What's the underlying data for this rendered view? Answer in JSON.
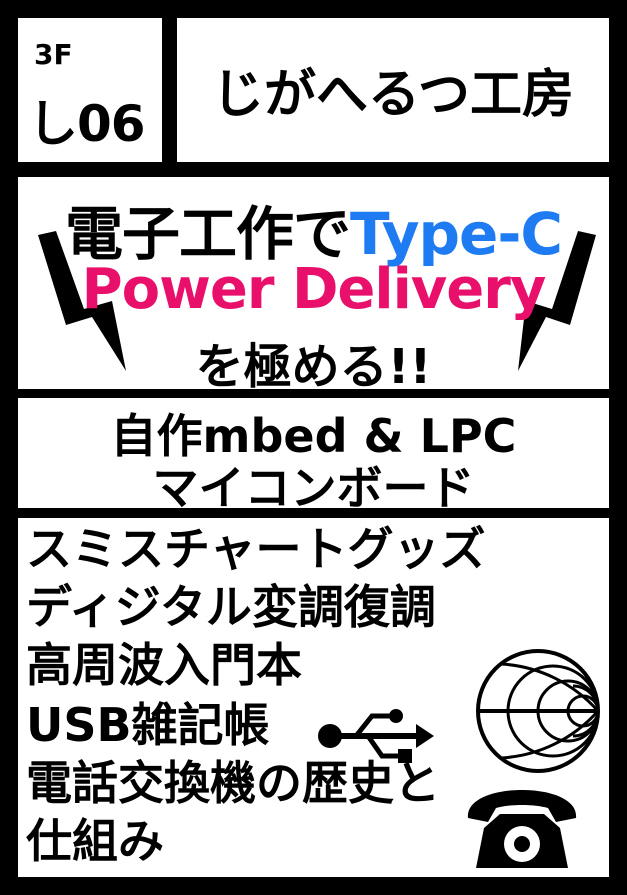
{
  "booth": {
    "floor": "3F",
    "number": "し06"
  },
  "circle": {
    "name": "じがへるつ工房"
  },
  "headline": {
    "line1_prefix": "電子工作で",
    "line1_highlight": "Type-C",
    "line2": "Power Delivery",
    "line3": "を極める!!"
  },
  "board": {
    "line1": "自作mbed & LPC",
    "line2": "マイコンボード"
  },
  "books": [
    "スミスチャートグッズ",
    "ディジタル変調復調",
    "高周波入門本",
    "USB雑記帳",
    "電話交換機の歴史と",
    "仕組み"
  ],
  "colors": {
    "background": "#000000",
    "panel": "#ffffff",
    "type_c": "#1f7bf2",
    "power_delivery": "#e8106a",
    "text": "#000000"
  },
  "icons": [
    "lightning-bolt-icon",
    "smith-chart-icon",
    "usb-icon",
    "telephone-icon"
  ]
}
